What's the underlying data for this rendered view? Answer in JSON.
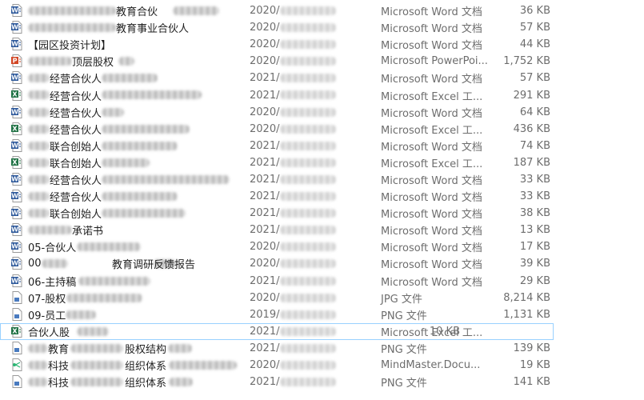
{
  "colors": {
    "word": "#2b579a",
    "excel": "#217346",
    "ppt": "#d24726",
    "image": "#4a7bbf",
    "mindmaster": "#2bb673",
    "selection": "#99d1ff"
  },
  "files": [
    {
      "name": "教育合伙",
      "date": "2020/",
      "type": "Microsoft Word 文档",
      "size": "36 KB",
      "icon": "word-icon"
    },
    {
      "name": "教育事业合伙人",
      "date": "2020/",
      "type": "Microsoft Word 文档",
      "size": "57 KB",
      "icon": "word-icon"
    },
    {
      "name": "【园区投资计划】",
      "date": "2020/",
      "type": "Microsoft Word 文档",
      "size": "44 KB",
      "icon": "word-icon"
    },
    {
      "name": "顶层股权",
      "date": "2020/",
      "type": "Microsoft PowerPoi...",
      "size": "1,752 KB",
      "icon": "powerpoint-icon"
    },
    {
      "name": "经营合伙人",
      "date": "2021/",
      "type": "Microsoft Word 文档",
      "size": "57 KB",
      "icon": "word-icon"
    },
    {
      "name": "经营合伙人",
      "date": "2021/",
      "type": "Microsoft Excel 工...",
      "size": "291 KB",
      "icon": "excel-icon"
    },
    {
      "name": "经营合伙人",
      "date": "2020/",
      "type": "Microsoft Word 文档",
      "size": "64 KB",
      "icon": "word-icon"
    },
    {
      "name": "经营合伙人",
      "date": "2020/",
      "type": "Microsoft Excel 工...",
      "size": "436 KB",
      "icon": "excel-icon"
    },
    {
      "name": "联合创始人",
      "date": "2021/",
      "type": "Microsoft Word 文档",
      "size": "74 KB",
      "icon": "word-icon"
    },
    {
      "name": "联合创始人",
      "date": "2021/",
      "type": "Microsoft Excel 工...",
      "size": "187 KB",
      "icon": "excel-icon"
    },
    {
      "name": "经营合伙人",
      "date": "2021/",
      "type": "Microsoft Word 文档",
      "size": "33 KB",
      "icon": "word-icon"
    },
    {
      "name": "经营合伙人",
      "date": "2021/",
      "type": "Microsoft Word 文档",
      "size": "33 KB",
      "icon": "word-icon"
    },
    {
      "name": "联合创始人",
      "date": "2021/",
      "type": "Microsoft Word 文档",
      "size": "38 KB",
      "icon": "word-icon"
    },
    {
      "name": "承诺书",
      "date": "2021/",
      "type": "Microsoft Word 文档",
      "size": "13 KB",
      "icon": "word-icon"
    },
    {
      "name": "05-合伙人",
      "date": "2020/",
      "type": "Microsoft Word 文档",
      "size": "17 KB",
      "icon": "word-icon"
    },
    {
      "name": "00",
      "name2": "教育调研反馈报告",
      "date": "2020/",
      "type": "Microsoft Word 文档",
      "size": "39 KB",
      "icon": "word-icon"
    },
    {
      "name": "06-主持稿",
      "date": "2021/",
      "type": "Microsoft Word 文档",
      "size": "29 KB",
      "icon": "word-icon"
    },
    {
      "name": "07-股权",
      "date": "2020/",
      "type": "JPG 文件",
      "size": "8,214 KB",
      "icon": "image-file-icon"
    },
    {
      "name": "09-员工",
      "date": "2019/",
      "type": "PNG 文件",
      "size": "1,131 KB",
      "icon": "image-file-icon"
    },
    {
      "name": "合伙人股",
      "date": "2021/",
      "type": "Microsoft Excel 工...",
      "size": "10 KB",
      "icon": "excel-icon"
    },
    {
      "name": "教育",
      "name2": "股权结构",
      "date": "2021/",
      "type": "PNG 文件",
      "size": "139 KB",
      "icon": "image-file-icon"
    },
    {
      "name": "科技",
      "name2": "组织体系",
      "date": "2020/",
      "type": "MindMaster.Docu...",
      "size": "19 KB",
      "icon": "mindmaster-icon"
    },
    {
      "name": "科技",
      "name2": "组织体系",
      "date": "2021/",
      "type": "PNG 文件",
      "size": "141 KB",
      "icon": "image-file-icon"
    }
  ]
}
